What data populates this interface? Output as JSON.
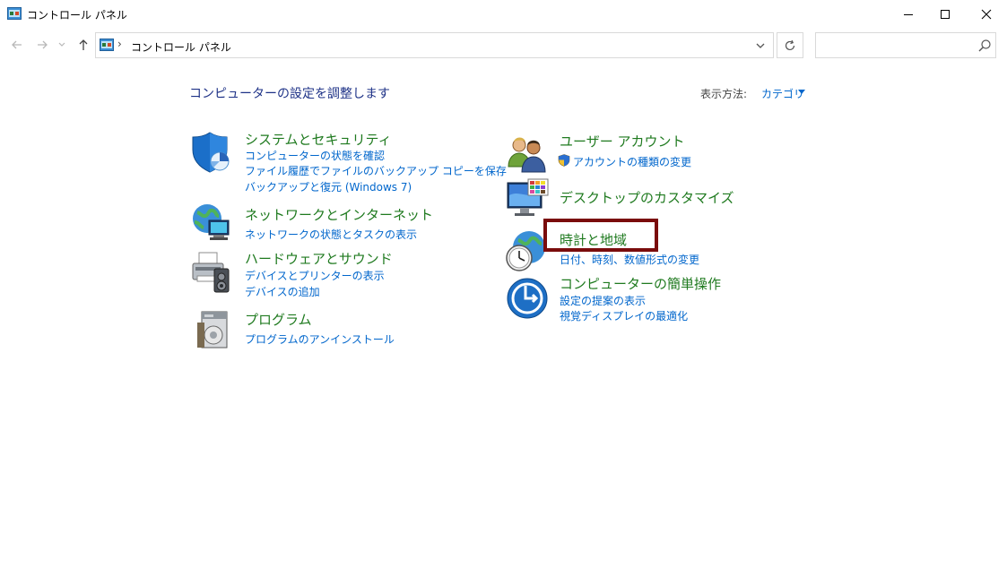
{
  "window": {
    "title": "コントロール パネル",
    "controls": [
      "minimize",
      "maximize",
      "close"
    ]
  },
  "addressbar": {
    "path": "コントロール パネル",
    "separator": "›"
  },
  "search": {
    "placeholder": ""
  },
  "main": {
    "heading": "コンピューターの設定を調整します",
    "view_by_label": "表示方法:",
    "view_by_value": "カテゴリ"
  },
  "categories_left": [
    {
      "title": "システムとセキュリティ",
      "icon": "shield-icon",
      "links": [
        "コンピューターの状態を確認",
        "ファイル履歴でファイルのバックアップ コピーを保存",
        "バックアップと復元 (Windows 7)"
      ]
    },
    {
      "title": "ネットワークとインターネット",
      "icon": "network-icon",
      "links": [
        "ネットワークの状態とタスクの表示"
      ]
    },
    {
      "title": "ハードウェアとサウンド",
      "icon": "printer-icon",
      "links": [
        "デバイスとプリンターの表示",
        "デバイスの追加"
      ]
    },
    {
      "title": "プログラム",
      "icon": "programs-icon",
      "links": [
        "プログラムのアンインストール"
      ]
    }
  ],
  "categories_right": [
    {
      "title": "ユーザー アカウント",
      "icon": "users-icon",
      "links": [
        "アカウントの種類の変更"
      ]
    },
    {
      "title": "デスクトップのカスタマイズ",
      "icon": "monitor-icon",
      "links": []
    },
    {
      "title": "時計と地域",
      "icon": "clock-globe-icon",
      "links": [
        "日付、時刻、数値形式の変更"
      ]
    },
    {
      "title": "コンピューターの簡単操作",
      "icon": "ease-of-access-icon",
      "links": [
        "設定の提案の表示",
        "視覚ディスプレイの最適化"
      ]
    }
  ],
  "colors": {
    "category_title": "#1f7a1f",
    "link": "#0066cc",
    "heading": "#1e3287",
    "highlight_border": "#7a0c0c"
  }
}
